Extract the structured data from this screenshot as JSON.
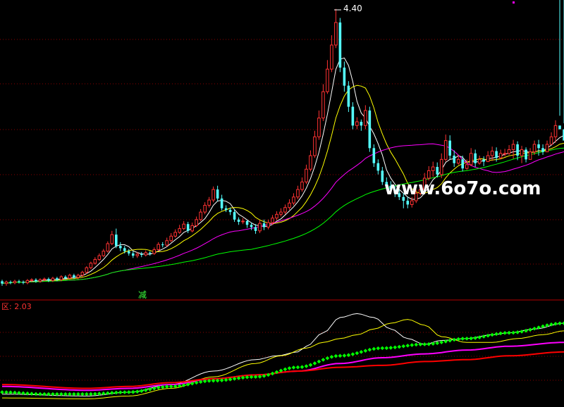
{
  "colors": {
    "background": "#000000",
    "grid": "#8b0000",
    "up": "#ff3232",
    "down": "#54ffff",
    "ma_short": "#ffffff",
    "ma_mid": "#ffff00",
    "ma_long": "#ff00ff",
    "ma_longest": "#00ff00",
    "text_red": "#ff3232",
    "text_green": "#3cff3c",
    "watermark": "#ffffff",
    "ind_white": "#ffffff",
    "ind_yellow": "#ffff00",
    "ind_magenta": "#ff00ff",
    "ind_red": "#ff0000",
    "ind_dots": "#00ff00"
  },
  "labels": {
    "high_label": "4.40",
    "reduce_label": "减",
    "indicator_label": "区: 2.03",
    "watermark": "www.6o7o.com"
  },
  "chart_data": [
    {
      "type": "candlestick",
      "name": "price",
      "ylim": [
        0.55,
        4.5
      ],
      "grid": true,
      "x": [
        0,
        1,
        2,
        3,
        4,
        5,
        6,
        7,
        8,
        9,
        10,
        11,
        12,
        13,
        14,
        15,
        16,
        17,
        18,
        19,
        20,
        21,
        22,
        23,
        24,
        25,
        26,
        27,
        28,
        29,
        30,
        31,
        32,
        33,
        34,
        35,
        36,
        37,
        38,
        39,
        40,
        41,
        42,
        43,
        44,
        45,
        46,
        47,
        48,
        49,
        50,
        51,
        52,
        53,
        54,
        55,
        56,
        57,
        58,
        59,
        60,
        61,
        62,
        63,
        64,
        65,
        66,
        67,
        68,
        69,
        70,
        71,
        72,
        73,
        74,
        75,
        76,
        77,
        78,
        79,
        80,
        81,
        82,
        83,
        84,
        85,
        86,
        87,
        88,
        89,
        90,
        91,
        92,
        93,
        94,
        95,
        96,
        97,
        98,
        99,
        100,
        101,
        102,
        103,
        104,
        105,
        106,
        107,
        108,
        109,
        110,
        111,
        112,
        113,
        114,
        115,
        116,
        117,
        118,
        119,
        120,
        121,
        122,
        123,
        124,
        125,
        126,
        127,
        128,
        129,
        130,
        131,
        132,
        133
      ],
      "open": [
        0.78,
        0.75,
        0.77,
        0.76,
        0.78,
        0.77,
        0.76,
        0.79,
        0.8,
        0.78,
        0.8,
        0.81,
        0.79,
        0.82,
        0.8,
        0.84,
        0.82,
        0.86,
        0.83,
        0.86,
        0.9,
        0.96,
        1.02,
        1.07,
        1.12,
        1.18,
        1.28,
        1.4,
        1.25,
        1.22,
        1.18,
        1.15,
        1.12,
        1.14,
        1.13,
        1.16,
        1.15,
        1.2,
        1.27,
        1.26,
        1.32,
        1.38,
        1.43,
        1.48,
        1.54,
        1.45,
        1.52,
        1.6,
        1.7,
        1.79,
        1.86,
        2.0,
        1.88,
        1.75,
        1.73,
        1.7,
        1.6,
        1.57,
        1.58,
        1.53,
        1.5,
        1.45,
        1.55,
        1.5,
        1.56,
        1.62,
        1.67,
        1.7,
        1.76,
        1.82,
        1.9,
        2.0,
        2.1,
        2.27,
        2.45,
        2.7,
        2.95,
        3.3,
        3.6,
        3.92,
        4.22,
        3.62,
        3.38,
        3.1,
        2.85,
        2.9,
        2.85,
        3.05,
        2.55,
        2.35,
        2.25,
        2.1,
        2.05,
        2.0,
        1.95,
        1.9,
        1.85,
        1.8,
        1.85,
        1.95,
        2.0,
        2.15,
        2.25,
        2.3,
        2.2,
        2.4,
        2.65,
        2.45,
        2.35,
        2.4,
        2.28,
        2.33,
        2.48,
        2.35,
        2.4,
        2.37,
        2.45,
        2.51,
        2.42,
        2.48,
        2.48,
        2.53,
        2.6,
        2.45,
        2.53,
        2.4,
        2.5,
        2.6,
        2.55,
        2.5,
        2.6,
        2.7,
        2.85,
        2.8
      ],
      "close": [
        0.75,
        0.77,
        0.76,
        0.78,
        0.77,
        0.76,
        0.79,
        0.8,
        0.78,
        0.8,
        0.81,
        0.79,
        0.82,
        0.8,
        0.84,
        0.82,
        0.86,
        0.83,
        0.86,
        0.9,
        0.96,
        1.02,
        1.07,
        1.12,
        1.18,
        1.28,
        1.4,
        1.25,
        1.22,
        1.18,
        1.15,
        1.12,
        1.14,
        1.13,
        1.16,
        1.15,
        1.2,
        1.27,
        1.26,
        1.32,
        1.38,
        1.43,
        1.48,
        1.54,
        1.45,
        1.52,
        1.6,
        1.7,
        1.79,
        1.86,
        2.0,
        1.88,
        1.75,
        1.73,
        1.7,
        1.6,
        1.57,
        1.58,
        1.53,
        1.5,
        1.45,
        1.55,
        1.5,
        1.56,
        1.62,
        1.67,
        1.7,
        1.76,
        1.82,
        1.9,
        2.0,
        2.1,
        2.27,
        2.45,
        2.7,
        2.95,
        3.3,
        3.6,
        3.92,
        4.22,
        3.62,
        3.38,
        3.1,
        2.85,
        2.9,
        2.85,
        3.05,
        2.55,
        2.35,
        2.25,
        2.1,
        2.05,
        2.0,
        1.95,
        1.9,
        1.85,
        1.8,
        1.85,
        1.95,
        2.0,
        2.15,
        2.25,
        2.3,
        2.2,
        2.4,
        2.65,
        2.45,
        2.35,
        2.4,
        2.28,
        2.33,
        2.48,
        2.35,
        2.4,
        2.37,
        2.45,
        2.51,
        2.42,
        2.48,
        2.48,
        2.53,
        2.6,
        2.45,
        2.53,
        2.4,
        2.5,
        2.6,
        2.55,
        2.5,
        2.6,
        2.7,
        2.85,
        2.8,
        2.65
      ],
      "high": [
        0.8,
        0.79,
        0.79,
        0.8,
        0.8,
        0.79,
        0.81,
        0.82,
        0.82,
        0.82,
        0.83,
        0.83,
        0.84,
        0.84,
        0.86,
        0.86,
        0.88,
        0.88,
        0.88,
        0.92,
        0.98,
        1.04,
        1.1,
        1.15,
        1.21,
        1.31,
        1.45,
        1.48,
        1.3,
        1.25,
        1.21,
        1.18,
        1.17,
        1.17,
        1.19,
        1.18,
        1.23,
        1.3,
        1.3,
        1.36,
        1.42,
        1.47,
        1.53,
        1.58,
        1.57,
        1.56,
        1.64,
        1.74,
        1.83,
        1.9,
        2.04,
        2.05,
        1.93,
        1.79,
        1.76,
        1.74,
        1.63,
        1.62,
        1.6,
        1.56,
        1.54,
        1.59,
        1.6,
        1.6,
        1.66,
        1.71,
        1.75,
        1.8,
        1.87,
        1.95,
        2.05,
        2.16,
        2.33,
        2.52,
        2.78,
        3.05,
        3.4,
        3.72,
        4.05,
        4.4,
        4.28,
        3.7,
        3.44,
        3.16,
        2.96,
        2.93,
        3.12,
        3.1,
        2.6,
        2.4,
        2.3,
        2.16,
        2.11,
        2.05,
        2.0,
        1.95,
        1.9,
        1.9,
        2.0,
        2.05,
        2.22,
        2.31,
        2.37,
        2.36,
        2.48,
        2.73,
        2.72,
        2.52,
        2.46,
        2.45,
        2.4,
        2.55,
        2.53,
        2.45,
        2.44,
        2.51,
        2.57,
        2.56,
        2.53,
        2.54,
        2.59,
        2.66,
        2.64,
        2.58,
        2.56,
        2.55,
        2.65,
        2.66,
        2.6,
        2.65,
        2.76,
        2.92,
        2.98,
        2.88
      ],
      "low": [
        0.72,
        0.72,
        0.74,
        0.74,
        0.75,
        0.74,
        0.74,
        0.77,
        0.76,
        0.76,
        0.78,
        0.77,
        0.77,
        0.78,
        0.78,
        0.8,
        0.8,
        0.81,
        0.81,
        0.84,
        0.88,
        0.94,
        1.0,
        1.05,
        1.1,
        1.16,
        1.26,
        1.22,
        1.18,
        1.15,
        1.12,
        1.09,
        1.09,
        1.1,
        1.11,
        1.12,
        1.13,
        1.18,
        1.23,
        1.24,
        1.3,
        1.36,
        1.41,
        1.46,
        1.42,
        1.43,
        1.5,
        1.58,
        1.67,
        1.76,
        1.83,
        1.84,
        1.72,
        1.7,
        1.66,
        1.57,
        1.53,
        1.54,
        1.49,
        1.46,
        1.41,
        1.42,
        1.46,
        1.47,
        1.53,
        1.59,
        1.64,
        1.67,
        1.73,
        1.79,
        1.87,
        1.97,
        2.07,
        2.24,
        2.42,
        2.66,
        2.91,
        3.27,
        3.56,
        3.88,
        3.56,
        3.3,
        3.03,
        2.8,
        2.8,
        2.78,
        2.8,
        2.5,
        2.3,
        2.2,
        2.06,
        2.0,
        1.95,
        1.9,
        1.86,
        1.75,
        1.75,
        1.76,
        1.82,
        1.92,
        1.98,
        2.12,
        2.17,
        2.16,
        2.15,
        2.37,
        2.4,
        2.3,
        2.33,
        2.24,
        2.26,
        2.31,
        2.3,
        2.33,
        2.31,
        2.38,
        2.38,
        2.37,
        2.4,
        2.44,
        2.46,
        2.41,
        2.39,
        2.35,
        2.36,
        2.47,
        2.46,
        2.45,
        2.46,
        2.57,
        2.66,
        2.62
      ],
      "ma_lines": [
        "MA5",
        "MA10",
        "MA30",
        "MA60"
      ],
      "annotations": [
        "4.40",
        "减"
      ]
    },
    {
      "type": "line",
      "name": "indicator",
      "ylim": [
        0,
        100
      ],
      "grid": true,
      "label": "区: 2.03",
      "x_start": 0,
      "x_end": 133,
      "series": [
        {
          "color_key": "ind_white",
          "x": [
            0,
            20,
            30,
            40,
            50,
            60,
            65,
            70,
            72,
            76,
            80,
            84,
            88,
            92,
            96,
            100,
            104,
            110,
            116,
            120,
            126,
            133
          ],
          "values": [
            12,
            10,
            14,
            22,
            36,
            48,
            52,
            56,
            62,
            76,
            92,
            96,
            92,
            80,
            70,
            64,
            68,
            70,
            74,
            76,
            80,
            86
          ]
        },
        {
          "color_key": "ind_yellow",
          "x": [
            0,
            20,
            30,
            40,
            50,
            60,
            66,
            72,
            76,
            80,
            84,
            88,
            92,
            96,
            100,
            104,
            110,
            116,
            122,
            128,
            133
          ],
          "values": [
            8,
            7,
            10,
            18,
            30,
            44,
            52,
            60,
            66,
            70,
            74,
            80,
            86,
            90,
            84,
            72,
            66,
            66,
            70,
            74,
            78
          ]
        },
        {
          "color_key": "ind_magenta",
          "x": [
            0,
            20,
            30,
            40,
            50,
            60,
            70,
            80,
            90,
            100,
            110,
            120,
            133
          ],
          "values": [
            20,
            16,
            18,
            22,
            28,
            32,
            36,
            44,
            50,
            54,
            58,
            62,
            66
          ]
        },
        {
          "color_key": "ind_red",
          "x": [
            0,
            20,
            30,
            40,
            50,
            60,
            70,
            80,
            90,
            100,
            110,
            120,
            133
          ],
          "values": [
            22,
            18,
            20,
            24,
            28,
            32,
            36,
            40,
            42,
            46,
            48,
            52,
            56
          ]
        },
        {
          "color_key": "ind_dots",
          "dotted": true,
          "x": [
            0,
            10,
            20,
            30,
            40,
            50,
            60,
            70,
            80,
            90,
            100,
            110,
            120,
            133
          ],
          "values": [
            14,
            12,
            12,
            14,
            20,
            26,
            30,
            40,
            52,
            60,
            64,
            70,
            76,
            86
          ]
        }
      ]
    }
  ]
}
